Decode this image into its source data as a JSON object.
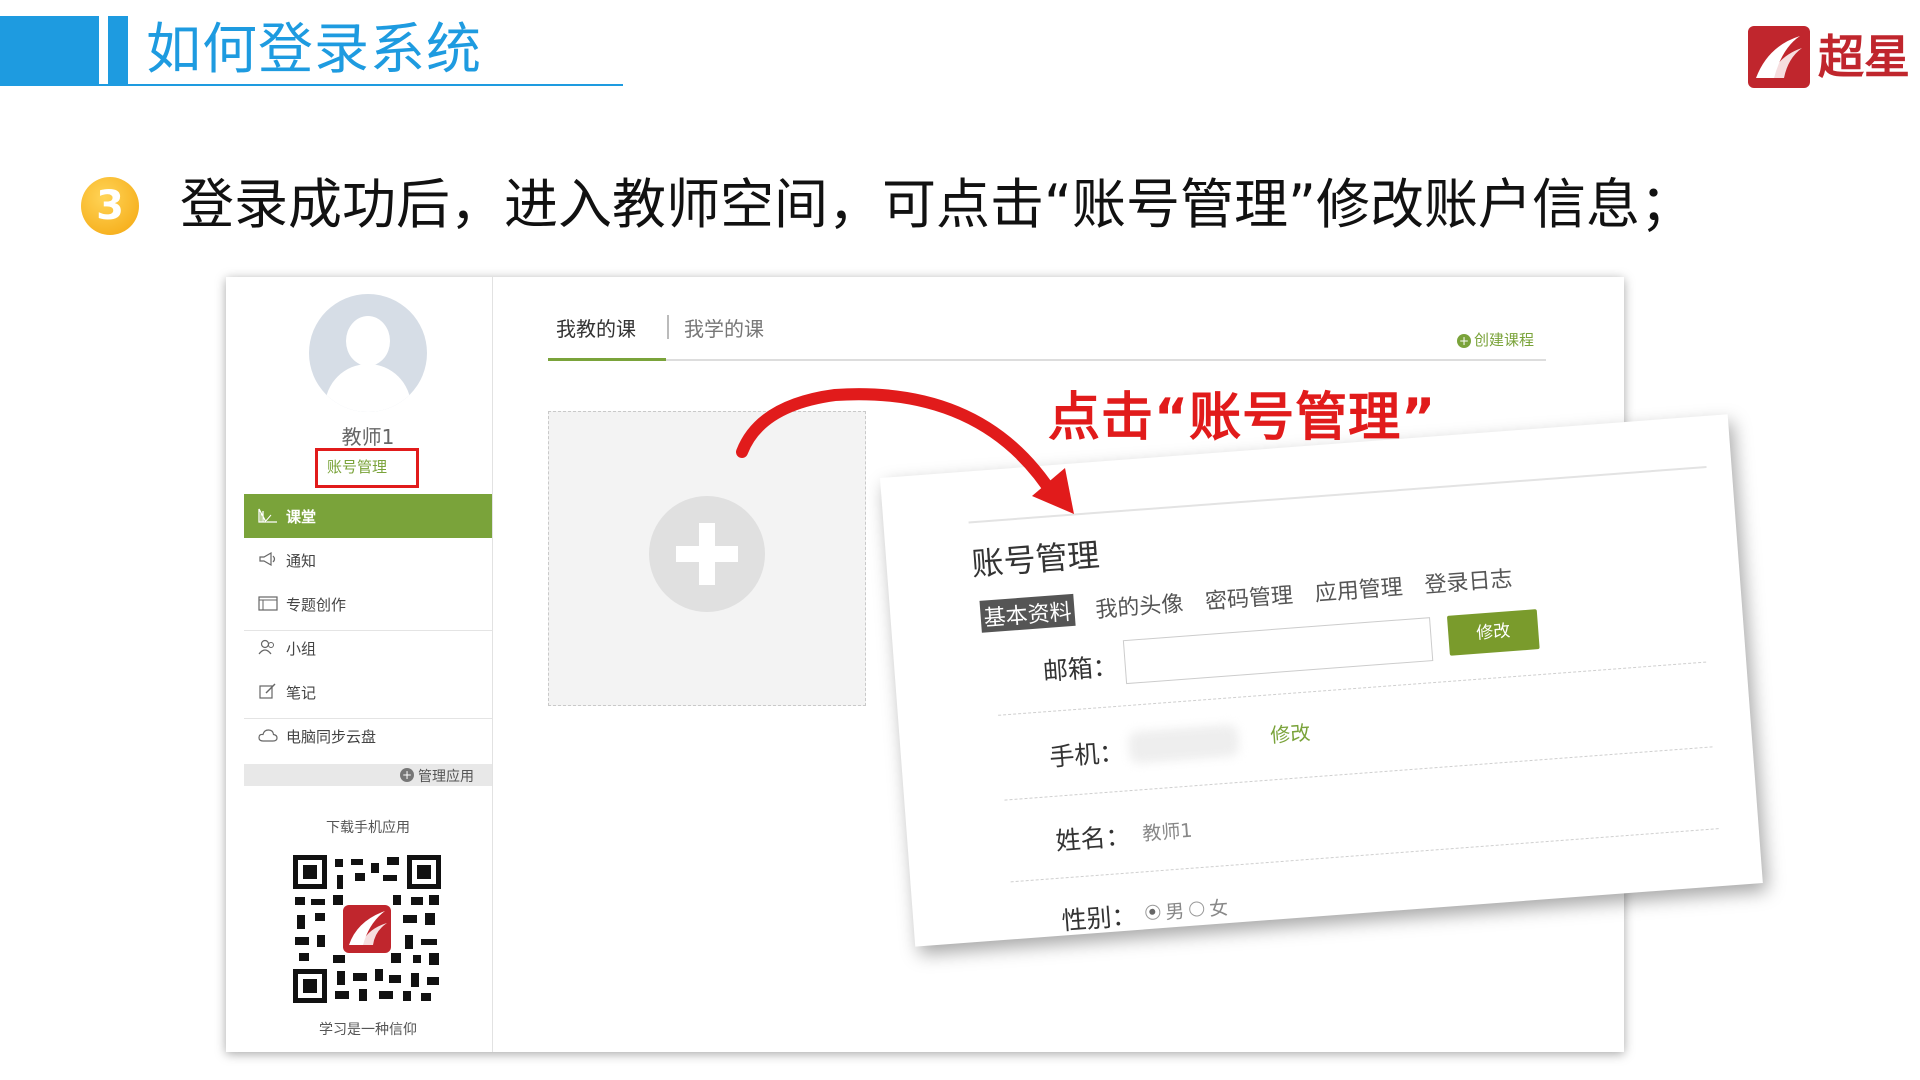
{
  "slide": {
    "title": "如何登录系统",
    "logo_text": "超星",
    "step_number": "3",
    "step_text": "登录成功后，进入教师空间，可点击“账号管理”修改账户信息；",
    "callout": "点击“账号管理”"
  },
  "sidebar": {
    "teacher_name": "教师1",
    "account_link": "账号管理",
    "items": [
      {
        "label": "课堂",
        "icon": "classroom-icon",
        "active": true
      },
      {
        "label": "通知",
        "icon": "megaphone-icon"
      },
      {
        "label": "专题创作",
        "icon": "window-icon"
      },
      {
        "label": "小组",
        "icon": "group-icon"
      },
      {
        "label": "笔记",
        "icon": "note-icon"
      },
      {
        "label": "电脑同步云盘",
        "icon": "cloud-icon"
      }
    ],
    "manage_apps": "管理应用",
    "download_label": "下载手机应用",
    "qr_caption": "学习是一种信仰"
  },
  "main": {
    "tabs": [
      "我教的课",
      "我学的课"
    ],
    "create_course": "创建课程"
  },
  "account_panel": {
    "title": "账号管理",
    "tabs": [
      "基本资料",
      "我的头像",
      "密码管理",
      "应用管理",
      "登录日志"
    ],
    "email_label": "邮箱：",
    "email_value": "",
    "edit_button": "修改",
    "phone_label": "手机：",
    "phone_edit": "修改",
    "name_label": "姓名：",
    "name_value": "教师1",
    "gender_label": "性别：",
    "gender_options": [
      "男",
      "女"
    ],
    "gender_selected": "男"
  },
  "colors": {
    "accent_blue": "#1e9be0",
    "brand_red": "#c0262d",
    "green": "#7aa33a",
    "highlight_red": "#e11b1b"
  }
}
